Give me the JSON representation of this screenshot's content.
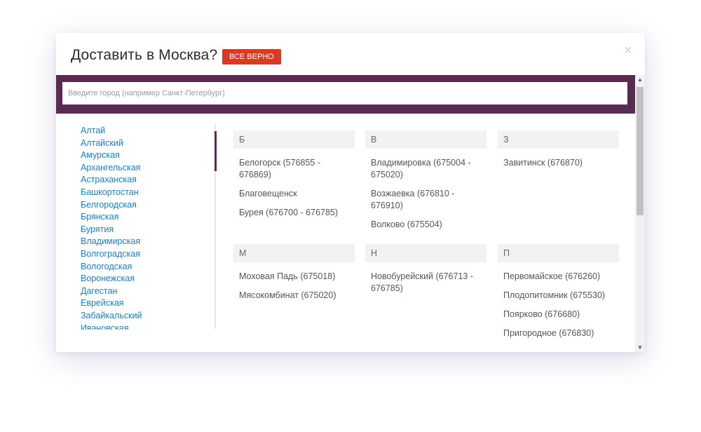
{
  "modal": {
    "title": "Доставить в Москва?",
    "confirm_label": "ВСЕ ВЕРНО",
    "close_icon": "×"
  },
  "search": {
    "placeholder": "Введите город (например Санкт-Петербург)",
    "value": ""
  },
  "regions": [
    "Алтай",
    "Алтайский",
    "Амурская",
    "Архангельская",
    "Астраханская",
    "Башкортостан",
    "Белгородская",
    "Брянская",
    "Бурятия",
    "Владимирская",
    "Волгоградская",
    "Вологодская",
    "Воронежская",
    "Дагестан",
    "Еврейская",
    "Забайкальский",
    "Ивановская"
  ],
  "groups": [
    {
      "letter": "Б",
      "cities": [
        "Белогорск (576855 - 676869)",
        "Благовещенск",
        "Бурея (676700 - 676785)"
      ]
    },
    {
      "letter": "В",
      "cities": [
        "Владимировка (675004 - 675020)",
        "Возжаевка (676810 - 676910)",
        "Волково (675504)"
      ]
    },
    {
      "letter": "З",
      "cities": [
        "Завитинск (676870)"
      ]
    },
    {
      "letter": "М",
      "cities": [
        "Моховая Падь (675018)",
        "Мясокомбинат (675020)"
      ]
    },
    {
      "letter": "Н",
      "cities": [
        "Новобурейский (676713 - 676785)"
      ]
    },
    {
      "letter": "П",
      "cities": [
        "Первомайское (676260)",
        "Плодопитомник (675530)",
        "Поярково (676680)",
        "Пригородное (676830)"
      ]
    }
  ],
  "colors": {
    "accent_purple": "#5a2b52",
    "confirm_red": "#d83a26",
    "link_blue": "#1a7ec6"
  },
  "icons": {
    "close": "close-icon",
    "scroll_up": "chevron-up-icon",
    "scroll_down": "chevron-down-icon"
  }
}
